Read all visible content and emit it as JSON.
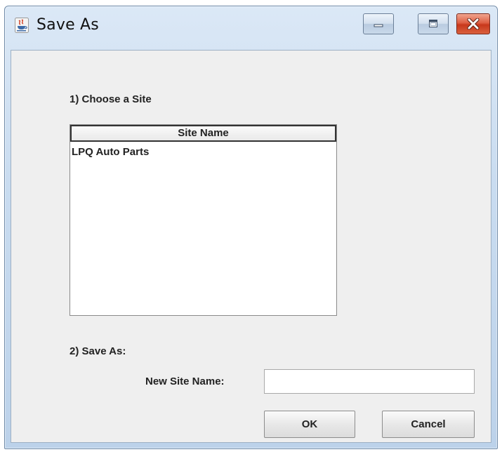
{
  "window": {
    "title": "Save As",
    "icon": "java-cup-icon"
  },
  "section1": {
    "label": "1) Choose a Site"
  },
  "table": {
    "column_header": "Site Name",
    "rows": [
      "LPQ Auto Parts"
    ]
  },
  "section2": {
    "label": "2) Save As:",
    "new_site_name_label": "New Site Name:",
    "new_site_name_value": ""
  },
  "buttons": {
    "ok": "OK",
    "cancel": "Cancel"
  }
}
